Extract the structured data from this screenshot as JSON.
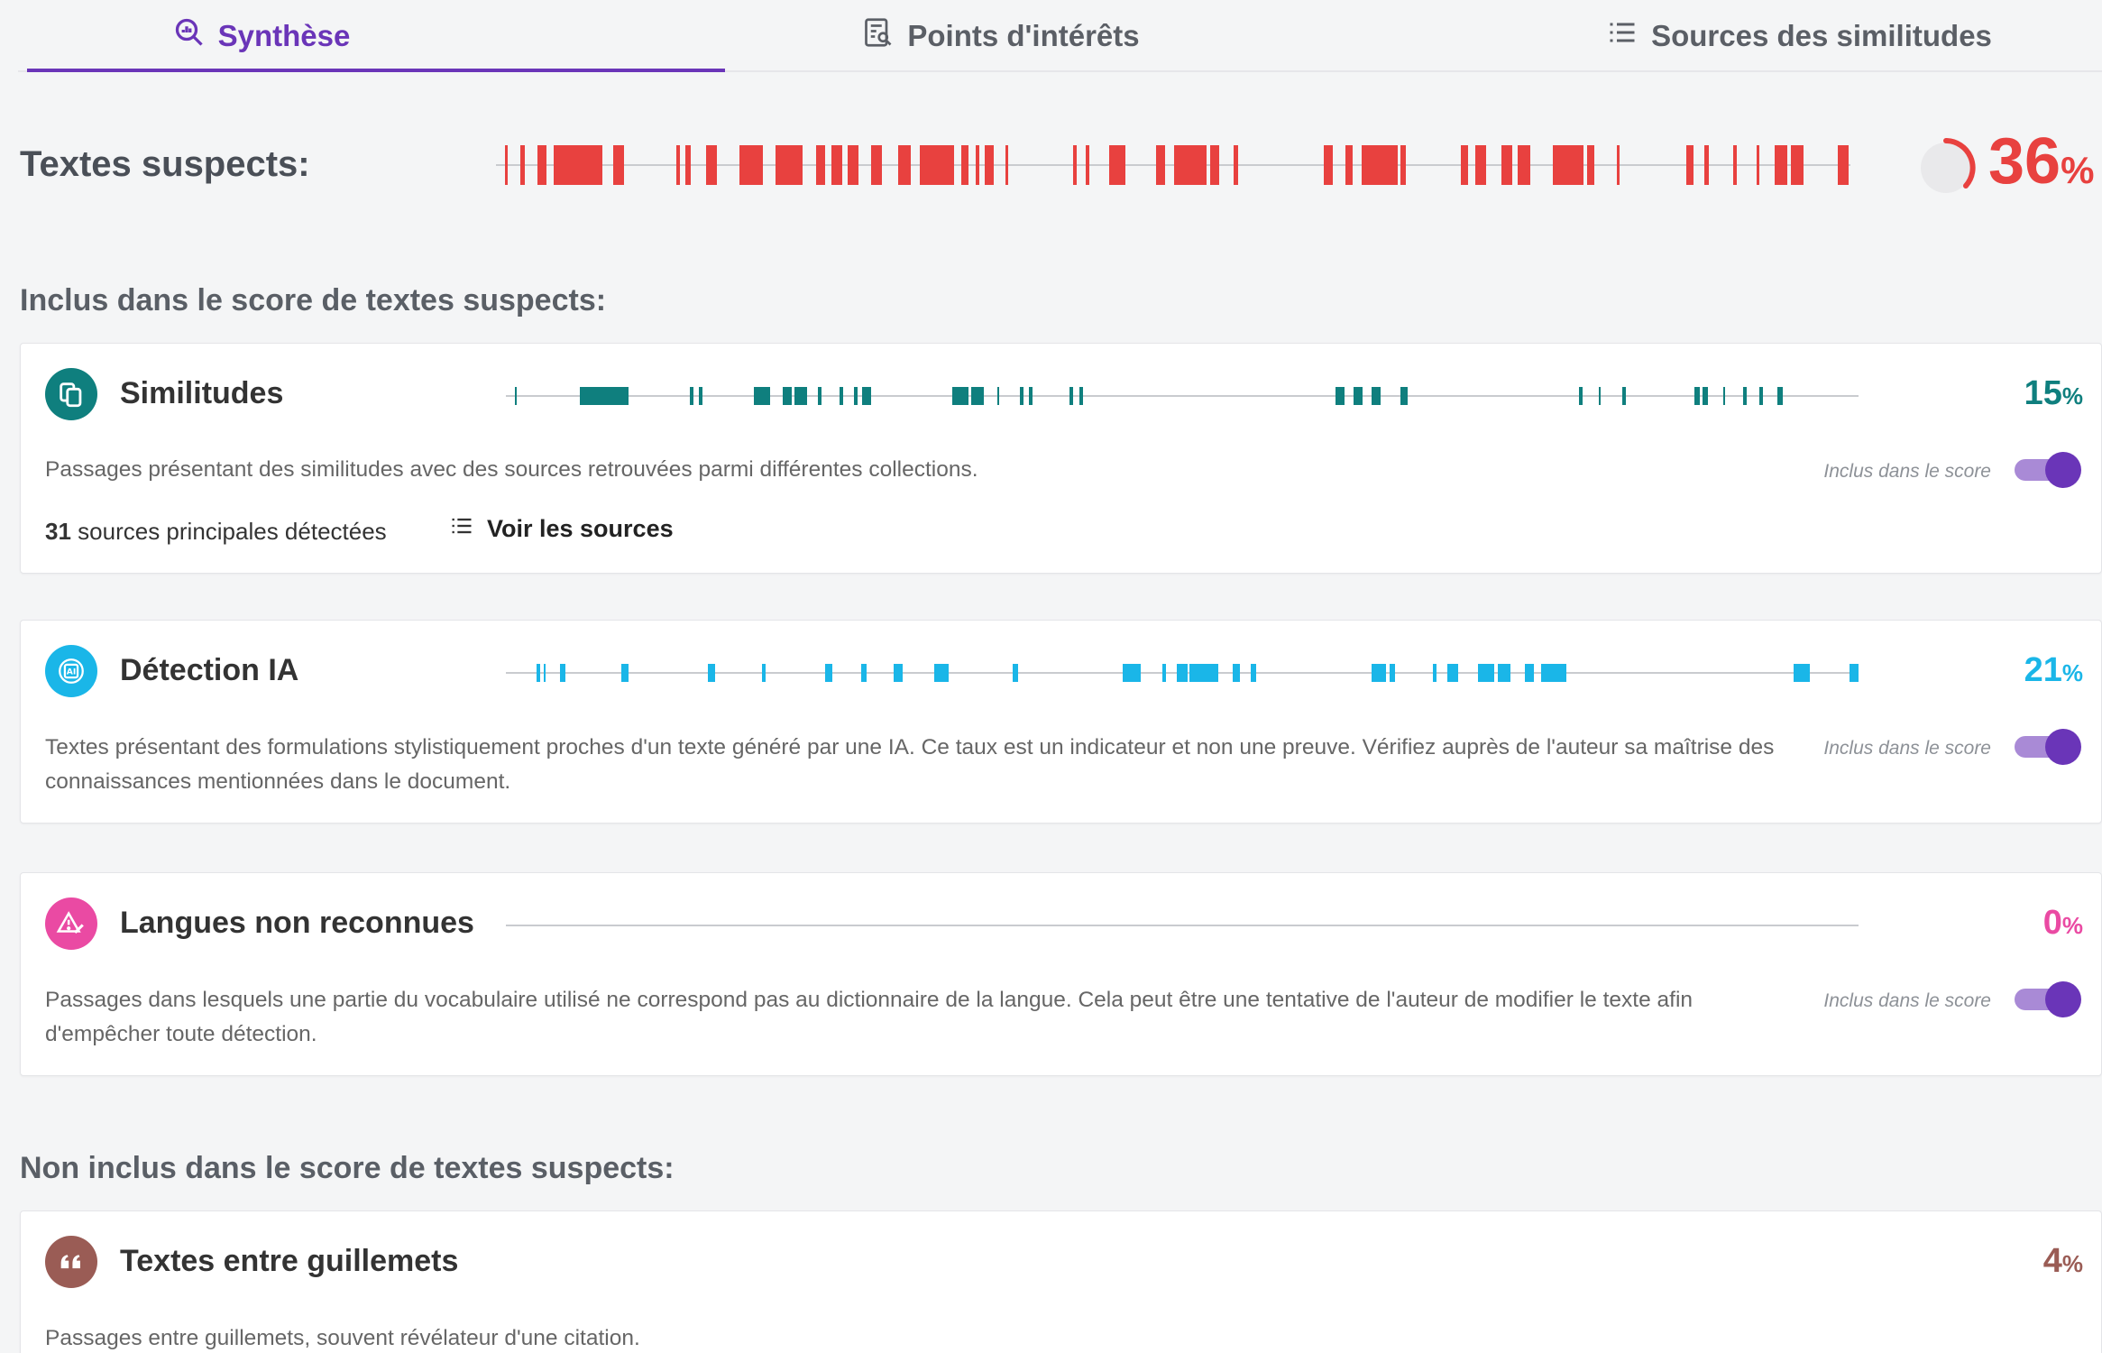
{
  "tabs": [
    {
      "label": "Synthèse",
      "icon": "search-chart-icon",
      "active": true
    },
    {
      "label": "Points d'intérêts",
      "icon": "document-search-icon",
      "active": false
    },
    {
      "label": "Sources des similitudes",
      "icon": "list-icon",
      "active": false
    }
  ],
  "suspects": {
    "label": "Textes suspects:",
    "percent": "36",
    "unit": "%",
    "color": "#e8413f",
    "fraction": 0.36
  },
  "included_label": "Inclus dans le score de textes suspects:",
  "excluded_label": "Non inclus dans le score de textes suspects:",
  "cards": {
    "similitudes": {
      "title": "Similitudes",
      "icon": "copy-icon",
      "color": "#0f7f7e",
      "percent": "15",
      "unit": "%",
      "description": "Passages présentant des similitudes avec des sources retrouvées parmi différentes collections.",
      "included_label": "Inclus dans le score",
      "toggle_on": true,
      "sources_count": "31",
      "sources_text": "sources principales détectées",
      "voir_sources": "Voir les sources"
    },
    "ia": {
      "title": "Détection IA",
      "icon": "ai-chip-icon",
      "color": "#1ab6e8",
      "percent": "21",
      "unit": "%",
      "description": "Textes présentant des formulations stylistiquement proches d'un texte généré par une IA. Ce taux est un indicateur et non une preuve. Vérifiez auprès de l'auteur sa maîtrise des connaissances mentionnées dans le document.",
      "included_label": "Inclus dans le score",
      "toggle_on": true
    },
    "langues": {
      "title": "Langues non reconnues",
      "icon": "warning-pen-icon",
      "color": "#ea4aa3",
      "percent": "0",
      "unit": "%",
      "description": "Passages dans lesquels une partie du vocabulaire utilisé ne correspond pas au dictionnaire de la langue. Cela peut être une tentative de l'auteur de modifier le texte afin d'empêcher toute détection.",
      "included_label": "Inclus dans le score",
      "toggle_on": true
    },
    "guillemets": {
      "title": "Textes entre guillemets",
      "icon": "quote-icon",
      "color": "#9a5c55",
      "percent": "4",
      "unit": "%",
      "description": "Passages entre guillemets, souvent révélateur d'une citation."
    }
  },
  "colors": {
    "accent": "#6a35b8",
    "track": "#c9cbcf"
  }
}
